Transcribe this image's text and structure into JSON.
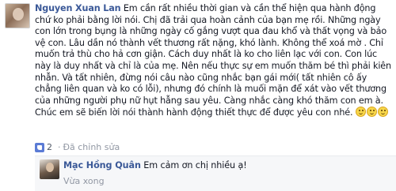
{
  "comment": {
    "author": "Nguyen Xuan Lan",
    "text": "Em cần rất nhiều thời gian và cần thể hiện qua hành động chứ ko phải bằng lời nói. Chị đã trải qua hoàn cảnh của bạn mẹ rồi. Những ngày con lớn trong bụng là những ngày cố gắng vượt qua đau khổ và thất vọng và bảo vệ con. Lâu dần nó thành vết thương rất nặng, khó lành. Không thể xoá mờ . Chỉ muốn trả thù cho hả cơn giận. Cách duy nhất là ko cho liên lạc với con. Con lúc này là duy nhất và chỉ là của mẹ. Nên nếu thực sự em muốn thăm bé thì phải kiên nhẫn. Và tất nhiên, đừng nói câu nào cũng nhắc bạn gái mới( tất nhiên cô ấy chẳng liên quan và ko có lỗi), nhưng đó chính là muối mặn để xát vào vết thương của những người phụ nữ hụt hẫng sau yêu. Càng nhắc càng khó thăm con em à. Chúc em sẽ biến lời nói thành hành động thiết thực để được yêu con nhé.",
    "emoji_count": 3,
    "likes": "2",
    "edited_label": "Đã chỉnh sửa",
    "separator": "·"
  },
  "reply": {
    "author": "Mạc Hồng Quân",
    "text": "Em cảm ơn chị nhiều ạ!",
    "timestamp": "Vừa xong"
  },
  "colors": {
    "author_link": "#3b5998",
    "meta_gray": "#9197a3",
    "reply_bg": "#f6f7f9",
    "like_blue": "#5b7bd5"
  },
  "icons": {
    "like": "thumbs-up-icon",
    "emoji": "smiley-icon"
  }
}
